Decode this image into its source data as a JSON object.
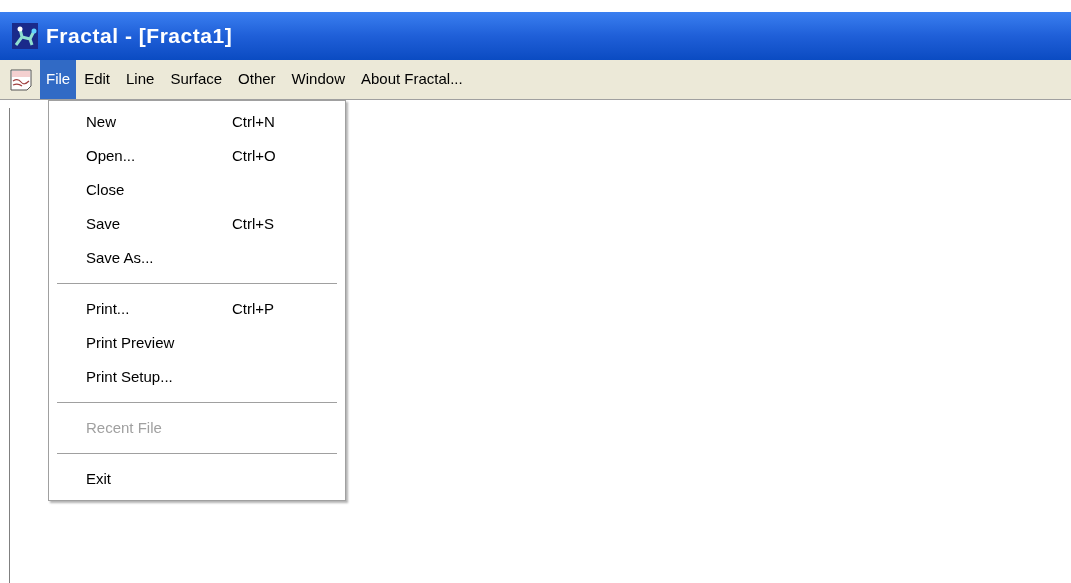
{
  "window": {
    "title": "Fractal - [Fracta1]"
  },
  "menu_bar": [
    {
      "label": "File",
      "selected": true
    },
    {
      "label": "Edit",
      "selected": false
    },
    {
      "label": "Line",
      "selected": false
    },
    {
      "label": "Surface",
      "selected": false
    },
    {
      "label": "Other",
      "selected": false
    },
    {
      "label": "Window",
      "selected": false
    },
    {
      "label": "About Fractal...",
      "selected": false
    }
  ],
  "file_menu": [
    {
      "kind": "item",
      "label": "New",
      "shortcut": "Ctrl+N",
      "disabled": false
    },
    {
      "kind": "item",
      "label": "Open...",
      "shortcut": "Ctrl+O",
      "disabled": false
    },
    {
      "kind": "item",
      "label": "Close",
      "disabled": false
    },
    {
      "kind": "item",
      "label": "Save",
      "shortcut": "Ctrl+S",
      "disabled": false
    },
    {
      "kind": "item",
      "label": "Save As...",
      "disabled": false
    },
    {
      "kind": "separator"
    },
    {
      "kind": "item",
      "label": "Print...",
      "shortcut": "Ctrl+P",
      "disabled": false
    },
    {
      "kind": "item",
      "label": "Print Preview",
      "disabled": false
    },
    {
      "kind": "item",
      "label": "Print Setup...",
      "disabled": false
    },
    {
      "kind": "separator"
    },
    {
      "kind": "item",
      "label": "Recent File",
      "disabled": true
    },
    {
      "kind": "separator"
    },
    {
      "kind": "item",
      "label": "Exit",
      "disabled": false
    }
  ]
}
